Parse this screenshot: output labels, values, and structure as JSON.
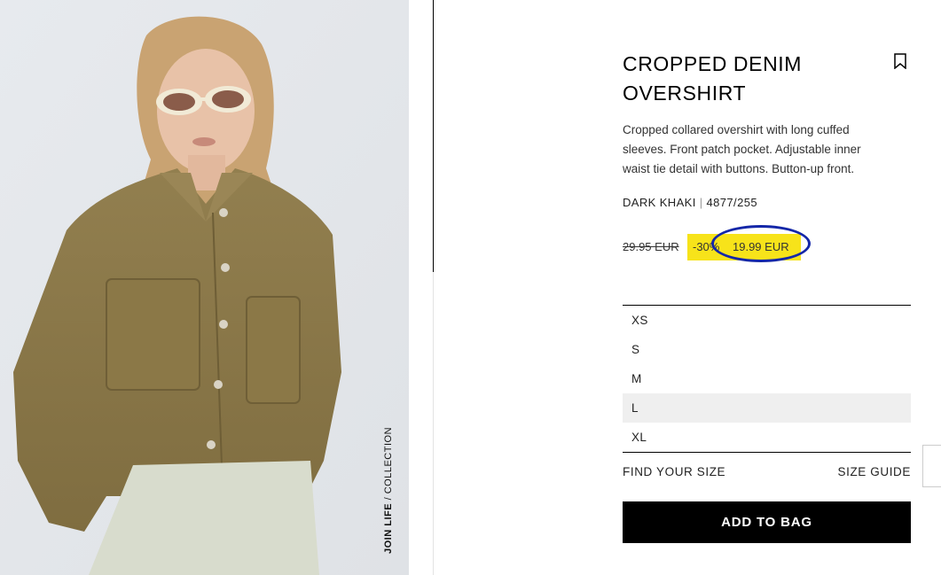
{
  "product": {
    "title": "CROPPED DENIM OVERSHIRT",
    "description": "Cropped collared overshirt with long cuffed sleeves. Front patch pocket. Adjustable inner waist tie detail with buttons. Button-up front.",
    "color": "DARK KHAKI",
    "reference": "4877/255",
    "old_price": "29.95 EUR",
    "discount": "-30%",
    "price": "19.99 EUR"
  },
  "image": {
    "badge_bold": "JOIN LIFE",
    "badge_rest": " / COLLECTION"
  },
  "sizes": [
    {
      "label": "XS",
      "selected": false
    },
    {
      "label": "S",
      "selected": false
    },
    {
      "label": "M",
      "selected": false
    },
    {
      "label": "L",
      "selected": true
    },
    {
      "label": "XL",
      "selected": false
    }
  ],
  "links": {
    "find_your_size": "FIND YOUR SIZE",
    "size_guide": "SIZE GUIDE"
  },
  "cta": {
    "add_to_bag": "ADD TO BAG"
  },
  "colors": {
    "sale_highlight": "#f7e31a",
    "annotation_circle": "#1427a8",
    "jacket": "#8a7a4c",
    "background_photo": "#e9ebee"
  },
  "icons": {
    "bookmark": "bookmark-icon"
  }
}
